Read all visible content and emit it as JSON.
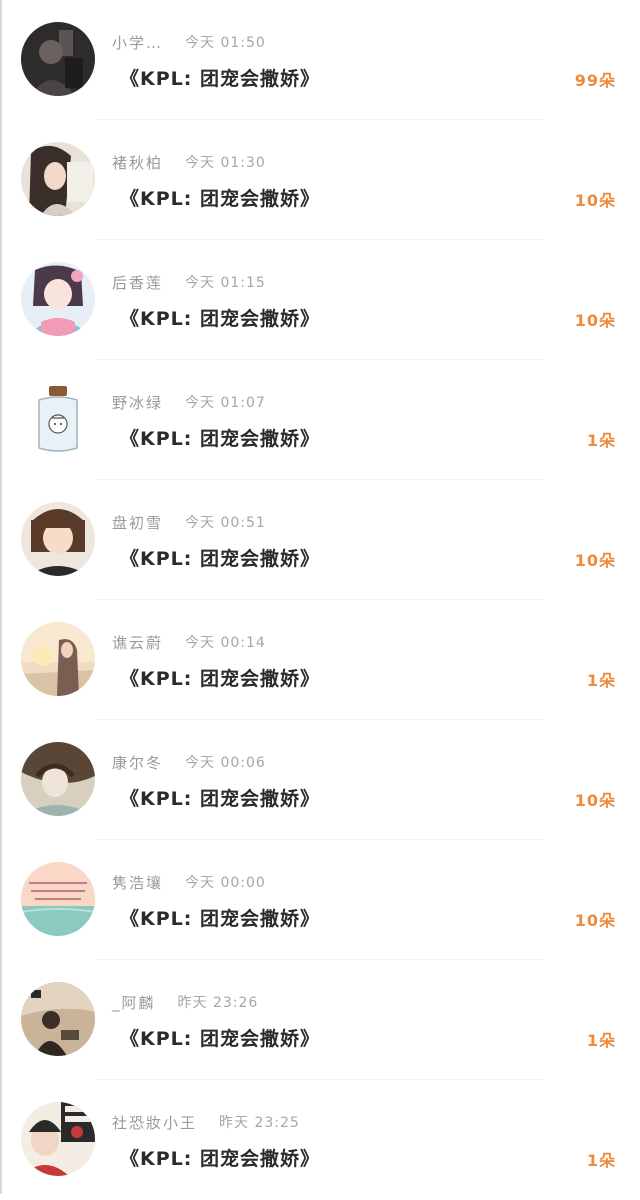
{
  "colors": {
    "name": "#9a9a9a",
    "time": "#a6a6a6",
    "message": "#2b2b2b",
    "count_accent": "#ee8a3a",
    "divider": "#f0f0f0"
  },
  "items": [
    {
      "name": "小学…",
      "time": "今天 01:50",
      "message": "《KPL: 团宠会撒娇》",
      "count": "99朵",
      "avatar_icon": "avatar-dark-photo"
    },
    {
      "name": "褚秋柏",
      "time": "今天 01:30",
      "message": "《KPL: 团宠会撒娇》",
      "count": "10朵",
      "avatar_icon": "avatar-girl-photo"
    },
    {
      "name": "后香莲",
      "time": "今天 01:15",
      "message": "《KPL: 团宠会撒娇》",
      "count": "10朵",
      "avatar_icon": "avatar-anime-girl"
    },
    {
      "name": "野冰绿",
      "time": "今天 01:07",
      "message": "《KPL: 团宠会撒娇》",
      "count": "1朵",
      "avatar_icon": "avatar-bottle"
    },
    {
      "name": "盘初雪",
      "time": "今天 00:51",
      "message": "《KPL: 团宠会撒娇》",
      "count": "10朵",
      "avatar_icon": "avatar-child-photo"
    },
    {
      "name": "谯云蔚",
      "time": "今天 00:14",
      "message": "《KPL: 团宠会撒娇》",
      "count": "1朵",
      "avatar_icon": "avatar-sunset-girl"
    },
    {
      "name": "康尔冬",
      "time": "今天 00:06",
      "message": "《KPL: 团宠会撒娇》",
      "count": "10朵",
      "avatar_icon": "avatar-illustration"
    },
    {
      "name": "隽浩壤",
      "time": "今天 00:00",
      "message": "《KPL: 团宠会撒娇》",
      "count": "10朵",
      "avatar_icon": "avatar-text-sea"
    },
    {
      "name": "_阿麟",
      "time": "昨天 23:26",
      "message": "《KPL: 团宠会撒娇》",
      "count": "1朵",
      "avatar_icon": "avatar-person-outdoor"
    },
    {
      "name": "社恐妝小王",
      "time": "昨天 23:25",
      "message": "《KPL: 团宠会撒娇》",
      "count": "1朵",
      "avatar_icon": "avatar-poster"
    }
  ]
}
